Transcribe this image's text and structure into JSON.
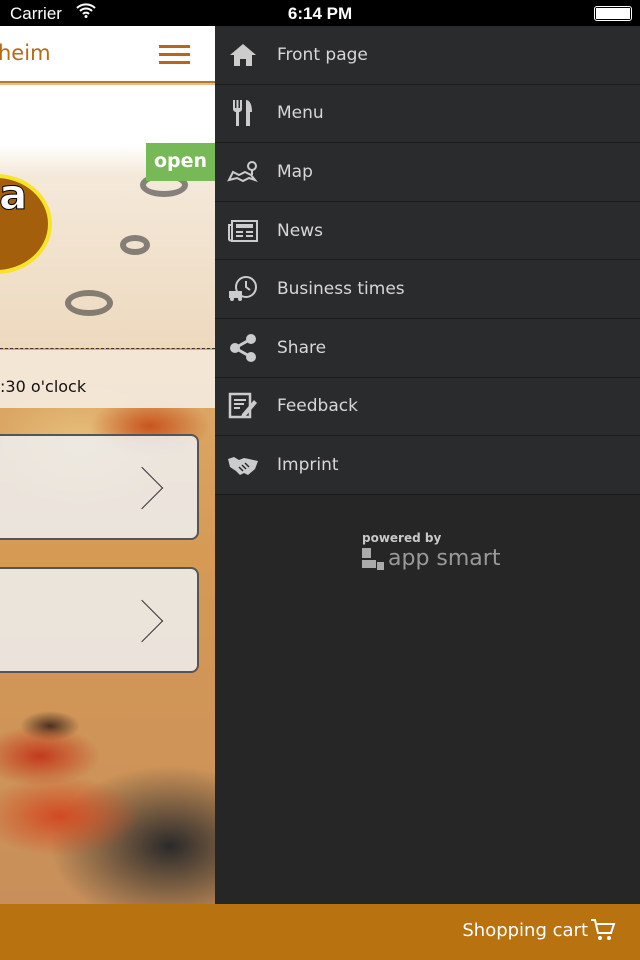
{
  "status_bar": {
    "carrier": "Carrier",
    "time": "6:14 PM"
  },
  "header": {
    "title": "heim"
  },
  "status_badge": "open",
  "logo": {
    "text": "a"
  },
  "hours": ":30 o'clock",
  "drawer": {
    "items": [
      {
        "label": "Front page",
        "icon": "home-icon"
      },
      {
        "label": "Menu",
        "icon": "fork-knife-icon"
      },
      {
        "label": "Map",
        "icon": "map-icon"
      },
      {
        "label": "News",
        "icon": "newspaper-icon"
      },
      {
        "label": "Business times",
        "icon": "delivery-clock-icon"
      },
      {
        "label": "Share",
        "icon": "share-icon"
      },
      {
        "label": "Feedback",
        "icon": "feedback-icon"
      },
      {
        "label": "Imprint",
        "icon": "handshake-icon"
      }
    ],
    "powered_by": "powered by",
    "brand": "app smart"
  },
  "footer": {
    "cart_label": "Shopping cart"
  },
  "colors": {
    "accent": "#b8720f",
    "open": "#77b956",
    "drawer": "#2a2b2d"
  }
}
